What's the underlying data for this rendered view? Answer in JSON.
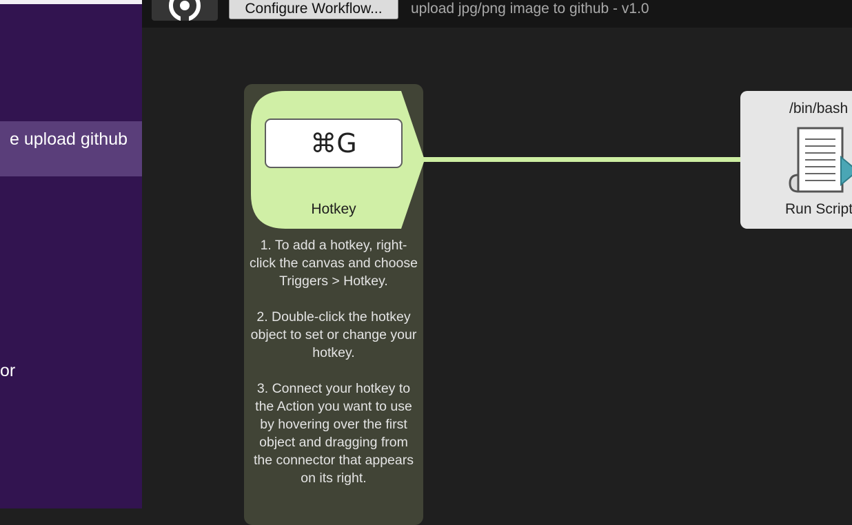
{
  "sidebar": {
    "items": [
      {
        "label": "e upload github",
        "selected": true
      },
      {
        "label": "or",
        "selected": false
      }
    ]
  },
  "toolbar": {
    "workflow_icon": "workflow-logo-icon",
    "configure_label": "Configure Workflow...",
    "title": "upload jpg/png image to github - v1.0"
  },
  "canvas": {
    "hotkey": {
      "key": "⌘G",
      "label": "Hotkey",
      "instructions": [
        "1. To add a hotkey, right-click the canvas and choose Triggers > Hotkey.",
        "2. Double-click the hotkey object to set or change your hotkey.",
        "3. Connect your hotkey to the Action you want to use by hovering over the first object and dragging from the connector that appears on its right."
      ]
    },
    "script": {
      "language": "/bin/bash",
      "label": "Run Script",
      "icon": "script-document-icon"
    }
  },
  "colors": {
    "sidebar_bg": "#321450",
    "sidebar_selected": "#5a3e7a",
    "canvas_bg": "#1f1f1f",
    "hotkey_green": "#d0efa6",
    "hotkey_panel": "#414436",
    "connector": "#cdeea2",
    "script_node": "#e6e6e6",
    "script_arrow": "#4aa6b5"
  }
}
